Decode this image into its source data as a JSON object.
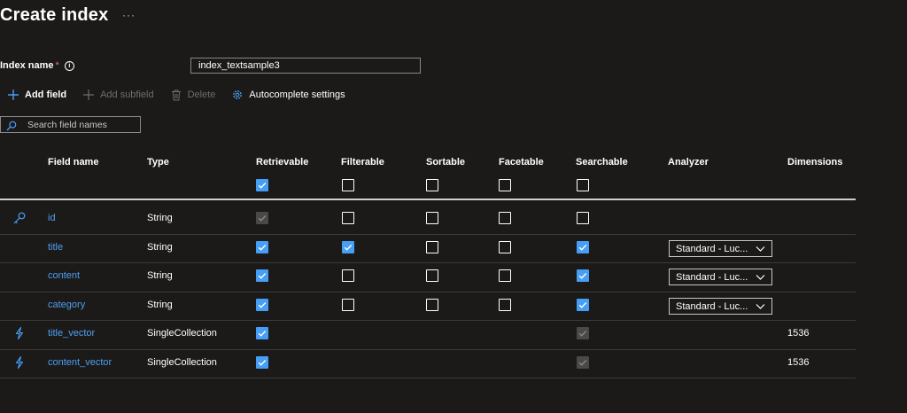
{
  "page": {
    "title": "Create index",
    "more_label": "···"
  },
  "index_name": {
    "label": "Index name",
    "required_mark": "*",
    "info_glyph": "i",
    "value": "index_textsample3"
  },
  "toolbar": {
    "add_field": "Add field",
    "add_subfield": "Add subfield",
    "delete": "Delete",
    "autocomplete": "Autocomplete settings"
  },
  "search": {
    "placeholder": "Search field names"
  },
  "columns": {
    "field_name": "Field name",
    "type": "Type",
    "retrievable": "Retrievable",
    "filterable": "Filterable",
    "sortable": "Sortable",
    "facetable": "Facetable",
    "searchable": "Searchable",
    "analyzer": "Analyzer",
    "dimensions": "Dimensions"
  },
  "header_checks": {
    "retrievable": "on",
    "filterable": "off",
    "sortable": "off",
    "facetable": "off",
    "searchable": "off"
  },
  "rows": [
    {
      "icon": "key-icon",
      "name": "id",
      "type": "String",
      "retrievable": "dim",
      "filterable": "off",
      "sortable": "off",
      "facetable": "off",
      "searchable": "off",
      "analyzer": "",
      "dimensions": ""
    },
    {
      "icon": "",
      "name": "title",
      "type": "String",
      "retrievable": "on",
      "filterable": "on",
      "sortable": "off",
      "facetable": "off",
      "searchable": "on",
      "analyzer": "Standard - Luc...",
      "dimensions": ""
    },
    {
      "icon": "",
      "name": "content",
      "type": "String",
      "retrievable": "on",
      "filterable": "off",
      "sortable": "off",
      "facetable": "off",
      "searchable": "on",
      "analyzer": "Standard - Luc...",
      "dimensions": ""
    },
    {
      "icon": "",
      "name": "category",
      "type": "String",
      "retrievable": "on",
      "filterable": "off",
      "sortable": "off",
      "facetable": "off",
      "searchable": "on",
      "analyzer": "Standard - Luc...",
      "dimensions": ""
    },
    {
      "icon": "lightning-icon",
      "name": "title_vector",
      "type": "SingleCollection",
      "retrievable": "on",
      "filterable": "none",
      "sortable": "none",
      "facetable": "none",
      "searchable": "dim",
      "analyzer": "",
      "dimensions": "1536"
    },
    {
      "icon": "lightning-icon",
      "name": "content_vector",
      "type": "SingleCollection",
      "retrievable": "on",
      "filterable": "none",
      "sortable": "none",
      "facetable": "none",
      "searchable": "dim",
      "analyzer": "",
      "dimensions": "1536"
    }
  ],
  "colors": {
    "background": "#1b1a19",
    "accent": "#479ef5",
    "field_link": "#4f9ff0",
    "required": "#f1707b"
  }
}
